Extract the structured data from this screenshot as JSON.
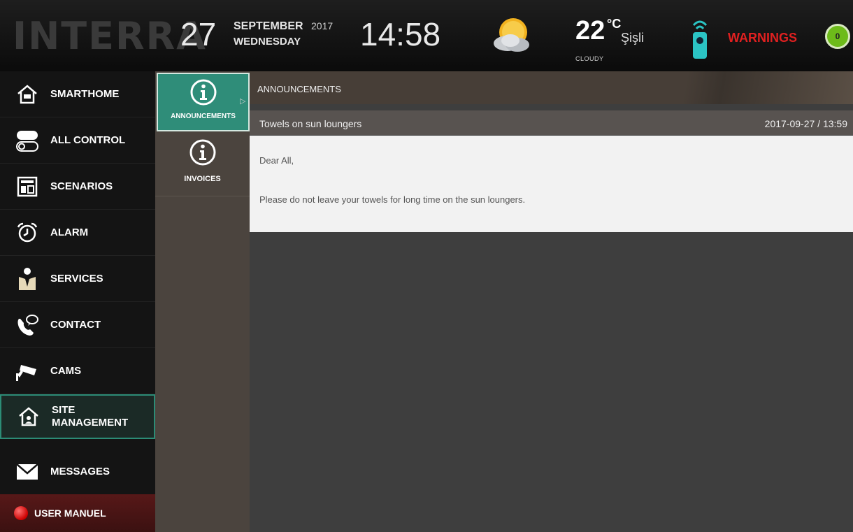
{
  "header": {
    "logo": "INTERRA",
    "day": "27",
    "month": "SEPTEMBER",
    "year": "2017",
    "weekday": "WEDNESDAY",
    "time": "14:58",
    "weather_icon": "cloudy-sun-icon",
    "temperature": "22",
    "unit": "°C",
    "city": "Şişli",
    "condition": "CLOUDY",
    "warnings_label": "WARNINGS",
    "warnings_count": "0"
  },
  "sidebar": {
    "items": [
      {
        "label": "SMARTHOME",
        "icon": "home-icon"
      },
      {
        "label": "ALL CONTROL",
        "icon": "toggle-icon"
      },
      {
        "label": "SCENARIOS",
        "icon": "scenario-icon"
      },
      {
        "label": "ALARM",
        "icon": "alarm-clock-icon"
      },
      {
        "label": "SERVICES",
        "icon": "waiter-icon"
      },
      {
        "label": "CONTACT",
        "icon": "phone-chat-icon"
      },
      {
        "label": "CAMS",
        "icon": "camera-icon"
      },
      {
        "label": "SITE MANAGEMENT",
        "icon": "site-home-icon"
      },
      {
        "label": "MESSAGES",
        "icon": "envelope-icon"
      }
    ],
    "user_manual": "USER MANUEL"
  },
  "subnav": {
    "items": [
      {
        "label": "ANNOUNCEMENTS",
        "icon": "info-icon"
      },
      {
        "label": "INVOICES",
        "icon": "info-icon"
      }
    ]
  },
  "main": {
    "title": "ANNOUNCEMENTS",
    "message": {
      "subject": "Towels on sun loungers",
      "date": "2017-09-27 / 13:59",
      "greeting": "Dear All,",
      "body": "Please do not leave your towels for long time on the sun loungers."
    }
  },
  "colors": {
    "accent": "#2f8d79",
    "warning": "#e02020",
    "badge": "#6dbb1a"
  }
}
